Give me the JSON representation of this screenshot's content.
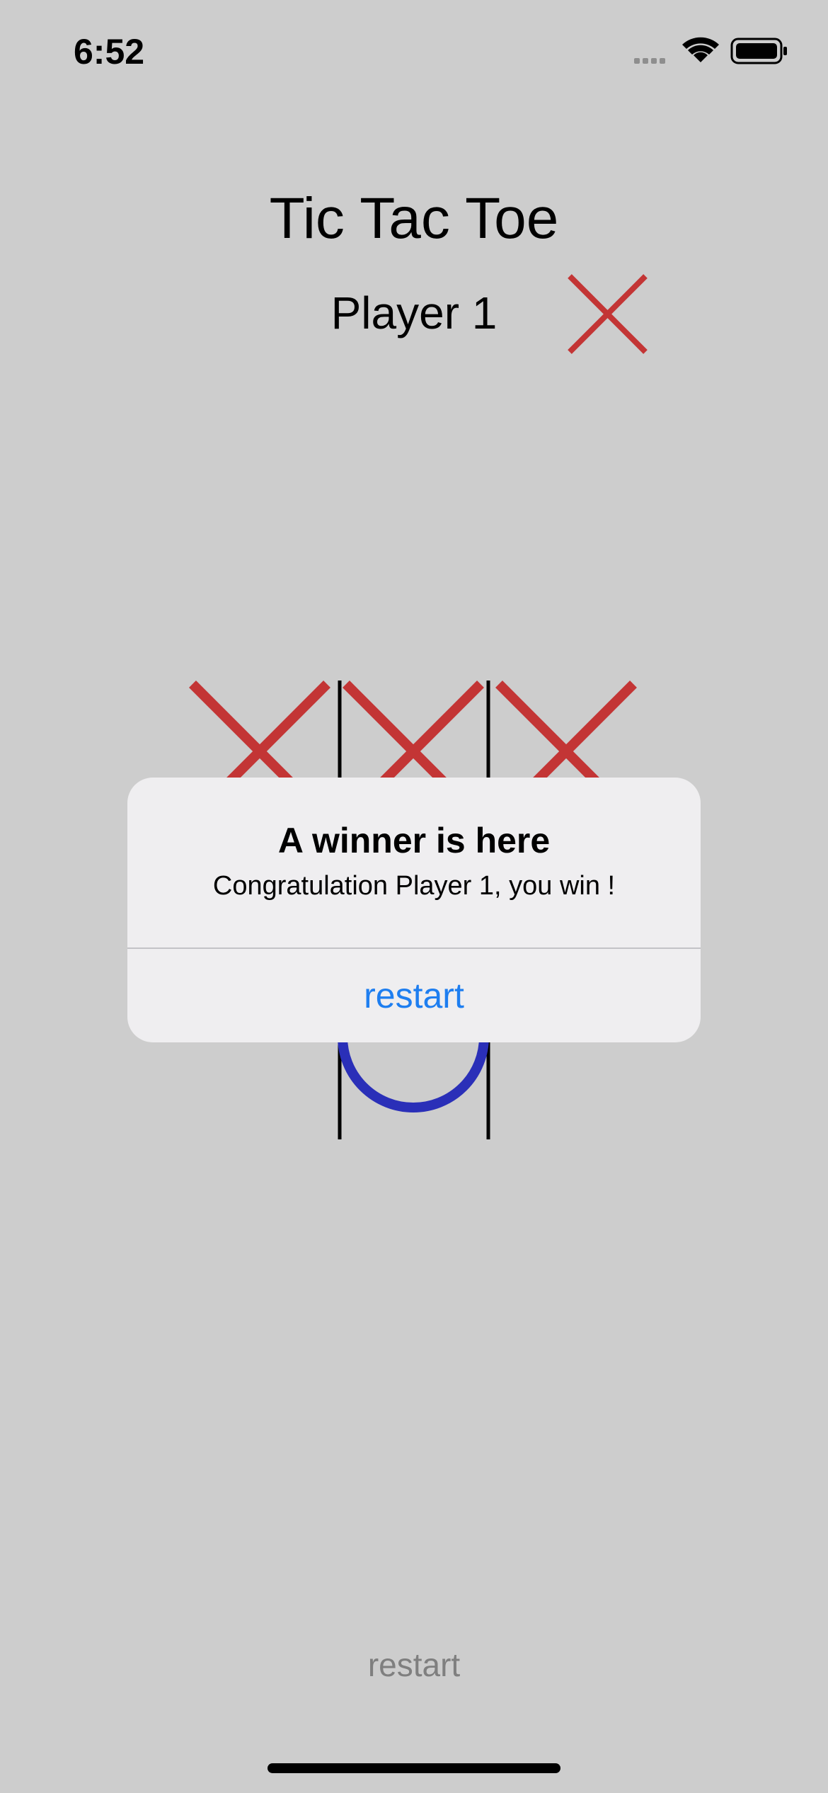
{
  "status_bar": {
    "time": "6:52",
    "icons": [
      "cellular-signal-icon",
      "wifi-icon",
      "battery-icon"
    ]
  },
  "game": {
    "title": "Tic Tac Toe",
    "current_player_label": "Player 1",
    "current_player_mark": "X",
    "board": [
      [
        "X",
        "X",
        "X"
      ],
      [
        "",
        "",
        ""
      ],
      [
        "",
        "O",
        ""
      ]
    ]
  },
  "alert": {
    "title": "A winner is here",
    "message": "Congratulation Player 1, you win !",
    "button_label": "restart"
  },
  "footer": {
    "restart_label": "restart"
  },
  "colors": {
    "background": "#cdcdcd",
    "x_mark": "#c33535",
    "o_mark": "#2a2fb8",
    "alert_button": "#1e7ef0"
  }
}
